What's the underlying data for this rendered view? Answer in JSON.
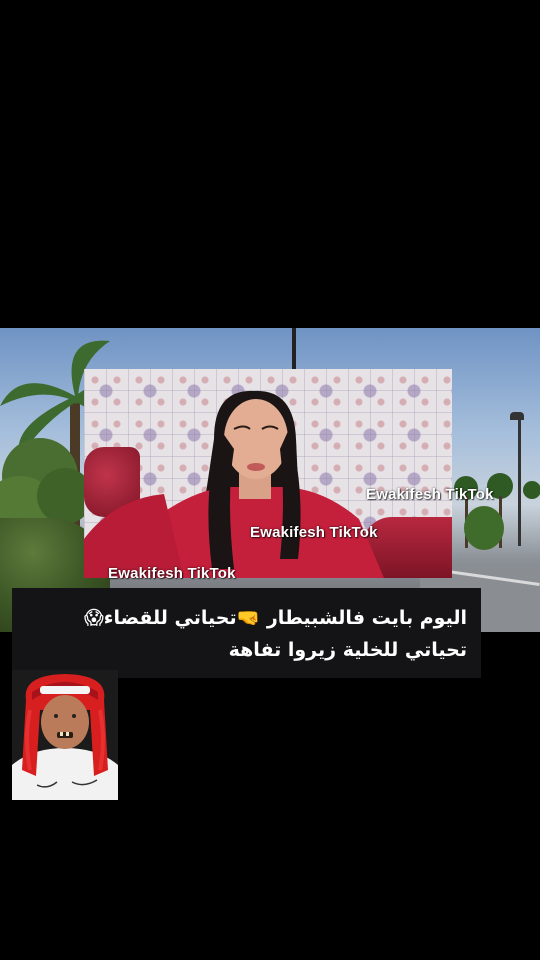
{
  "video": {
    "watermarks": [
      {
        "text": "Ewakifesh TikTok"
      },
      {
        "text": "Ewakifesh TikTok"
      },
      {
        "text": "Ewakifesh TikTok"
      }
    ]
  },
  "caption": {
    "line1": "اليوم بايت فالشبيطار 🤜تحياتي للقضاء😱",
    "line2": "تحياتي للخلية زيروا تفاهة"
  },
  "colors": {
    "background": "#000000",
    "caption_bg": "#141416",
    "dress": "#c41f3b",
    "wig": "#d81f1f"
  },
  "icons": {
    "emoji_scream": "face-screaming-icon",
    "emoji_fist": "fist-icon"
  }
}
